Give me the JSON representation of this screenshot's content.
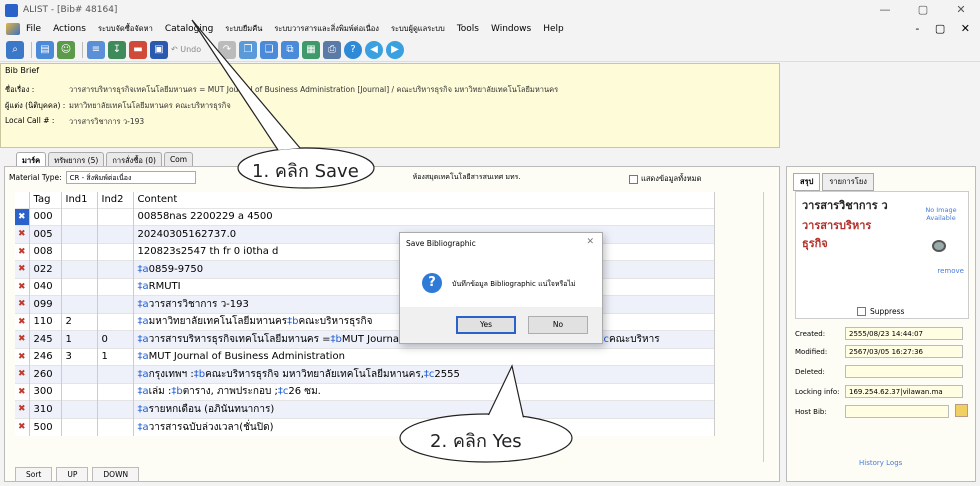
{
  "window": {
    "title": "ALIST - [Bib# 48164]",
    "controls": [
      "—",
      "▢",
      "✕"
    ]
  },
  "menu": {
    "items": [
      "File",
      "Actions",
      "ระบบจัดซื้อจัดหา",
      "Cataloging",
      "ระบบยืมคืน",
      "ระบบวารสารและสิ่งพิมพ์ต่อเนื่อง",
      "ระบบผู้ดูแลระบบ",
      "Tools",
      "Windows",
      "Help"
    ],
    "mdi_controls": "- ▢ ✕"
  },
  "toolbar": {
    "undo_label": "Undo"
  },
  "bib_brief": {
    "header": "Bib Brief",
    "rows": [
      {
        "label": "ชื่อเรื่อง :",
        "value": "วารสารบริหารธุรกิจเทคโนโลยีมหานคร = MUT Journal of Business Administration [Journal] / คณะบริหารธุรกิจ มหาวิทยาลัยเทคโนโลยีมหานคร"
      },
      {
        "label": "ผู้แต่ง (นิติบุคคล) :",
        "value": "มหาวิทยาลัยเทคโนโลยีมหานคร คณะบริหารธุรกิจ"
      },
      {
        "label": "Local Call # :",
        "value": "วารสารวิชาการ ว-193"
      }
    ]
  },
  "tabs": [
    "มาร์ค",
    "ทรัพยากร (5)",
    "การสั่งซื้อ (0)",
    "Com"
  ],
  "material_type": {
    "label": "Material Type:",
    "value": "CR - สิ่งพิมพ์ต่อเนื่อง",
    "library_value": "ห้องสมุดเทคโนโลยีสารสนเทศ มทร.",
    "show_all_label": "แสดงข้อมูลทั้งหมด"
  },
  "grid": {
    "columns": [
      "Tag",
      "Ind1",
      "Ind2",
      "Content"
    ],
    "rows": [
      {
        "tag": "000",
        "ind1": "",
        "ind2": "",
        "content": "00858nas  2200229 a 4500"
      },
      {
        "tag": "005",
        "ind1": "",
        "ind2": "",
        "content": "20240305162737.0"
      },
      {
        "tag": "008",
        "ind1": "",
        "ind2": "",
        "content": "120823s2547    th fr      0   i0tha d"
      },
      {
        "tag": "022",
        "ind1": "",
        "ind2": "",
        "content": "‡a0859-9750"
      },
      {
        "tag": "040",
        "ind1": "",
        "ind2": "",
        "content": "‡aRMUTI"
      },
      {
        "tag": "099",
        "ind1": "",
        "ind2": "",
        "content": "‡aวารสารวิชาการ ว-193"
      },
      {
        "tag": "110",
        "ind1": "2",
        "ind2": "",
        "content": "‡aมหาวิทยาลัยเทคโนโลยีมหานคร‡bคณะบริหารธุรกิจ"
      },
      {
        "tag": "245",
        "ind1": "1",
        "ind2": "0",
        "content": "‡aวารสารบริหารธุรกิจเทคโนโลยีมหานคร =‡bMUT Journal of Business Administration‡h[Journal] /‡cคณะบริหาร"
      },
      {
        "tag": "246",
        "ind1": "3",
        "ind2": "1",
        "content": "‡aMUT Journal of Business Administration"
      },
      {
        "tag": "260",
        "ind1": "",
        "ind2": "",
        "content": "‡aกรุงเทพฯ :‡bคณะบริหารธุรกิจ มหาวิทยาลัยเทคโนโลยีมหานคร,‡c2555"
      },
      {
        "tag": "300",
        "ind1": "",
        "ind2": "",
        "content": "‡aเล่ม :‡bตาราง, ภาพประกอบ ;‡c26 ซม."
      },
      {
        "tag": "310",
        "ind1": "",
        "ind2": "",
        "content": "‡aรายหกเดือน (อภินันทนาการ)"
      },
      {
        "tag": "500",
        "ind1": "",
        "ind2": "",
        "content": "‡aวารสารฉบับล่วงเวลา(ชั่นปิด)"
      }
    ]
  },
  "bottom_buttons": [
    "Sort",
    "UP",
    "DOWN"
  ],
  "right_panel": {
    "tabs": [
      "สรุป",
      "รายการโยง"
    ],
    "summary_lines": [
      "วารสารวิชาการ ว",
      "วารสารบริหาร",
      "ธุรกิจ"
    ],
    "no_image": "No Image Available",
    "remove": "remove",
    "suppress": "Suppress",
    "fields": [
      {
        "label": "Created:",
        "value": "2555/08/23 14:44:07"
      },
      {
        "label": "Modified:",
        "value": "2567/03/05 16:27:36"
      },
      {
        "label": "Deleted:",
        "value": ""
      },
      {
        "label": "Locking info:",
        "value": "169.254.62.37|vilawan.ma"
      },
      {
        "label": "Host Bib:",
        "value": ""
      }
    ],
    "history_logs": "History Logs"
  },
  "dialog": {
    "title": "Save Bibliographic",
    "message": "บันทึกข้อมูล Bibliographic แน่ใจหรือไม่",
    "yes": "Yes",
    "no": "No",
    "close": "✕"
  },
  "callouts": {
    "save": "1. คลิก Save",
    "yes": "2. คลิก Yes"
  }
}
